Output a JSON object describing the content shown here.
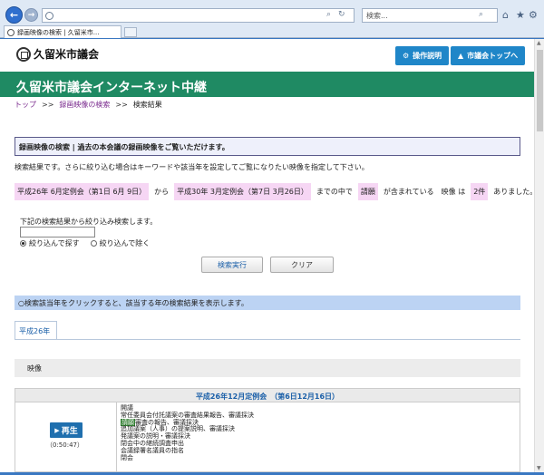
{
  "browser": {
    "tab_title": "録画映像の検索 | 久留米市...",
    "search_placeholder": "検索...",
    "icons": [
      "back-arrow-icon",
      "forward-arrow-icon",
      "page-icon",
      "search-icon",
      "refresh-icon",
      "home-icon",
      "star-icon",
      "gear-icon"
    ]
  },
  "header": {
    "logo_text": "久留米市議会",
    "btn_help": "操作説明",
    "btn_top": "市議会トップへ",
    "accent": "#1f86c8"
  },
  "banner": {
    "title": "久留米市議会インターネット中継",
    "color": "#1f8a63"
  },
  "breadcrumb": {
    "home": "トップ",
    "sep": ">>",
    "search": "録画映像の検索",
    "current": "検索結果"
  },
  "search_info": {
    "heading": "録画映像の検索 | 過去の本会議の録画映像をご覧いただけます。",
    "description": "検索結果です。さらに絞り込む場合はキーワードや該当年を設定してご覧になりたい映像を指定して下さい。",
    "from": "平成26年 6月定例会（第1日 6月 9日）",
    "kara": "から",
    "to": "平成30年 3月定例会（第7日 3月26日）",
    "madenonaka": "までの中で",
    "keyword": "請願",
    "fukumareteiru": "が含まれている　映像 は",
    "count": "2件",
    "arimashita": "ありました。"
  },
  "refine": {
    "label": "下記の検索結果から絞り込み検索します。",
    "input_value": "",
    "radio_include": "絞り込んで探す",
    "radio_exclude": "絞り込んで除く",
    "btn_search": "検索実行",
    "btn_clear": "クリア"
  },
  "notice": "○検索該当年をクリックすると、該当する年の検索結果を表示します。",
  "year_tab": "平成26年",
  "video_header": "映像",
  "session": {
    "title": "平成26年12月定例会　（第6日12月16日）",
    "play_label": "再生",
    "duration": "（0:50:47）",
    "agenda": [
      "開議",
      "常任委員会付託議案の審査結果報告、審議採決",
      "請願審査の報告、審議採決",
      "追加議案（人事）の提案説明、審議採決",
      "発議案の説明・審議採決",
      "閉会中の継続調査申出",
      "会議録署名議員の指名",
      "閉会"
    ],
    "agenda_highlight": "請願"
  }
}
